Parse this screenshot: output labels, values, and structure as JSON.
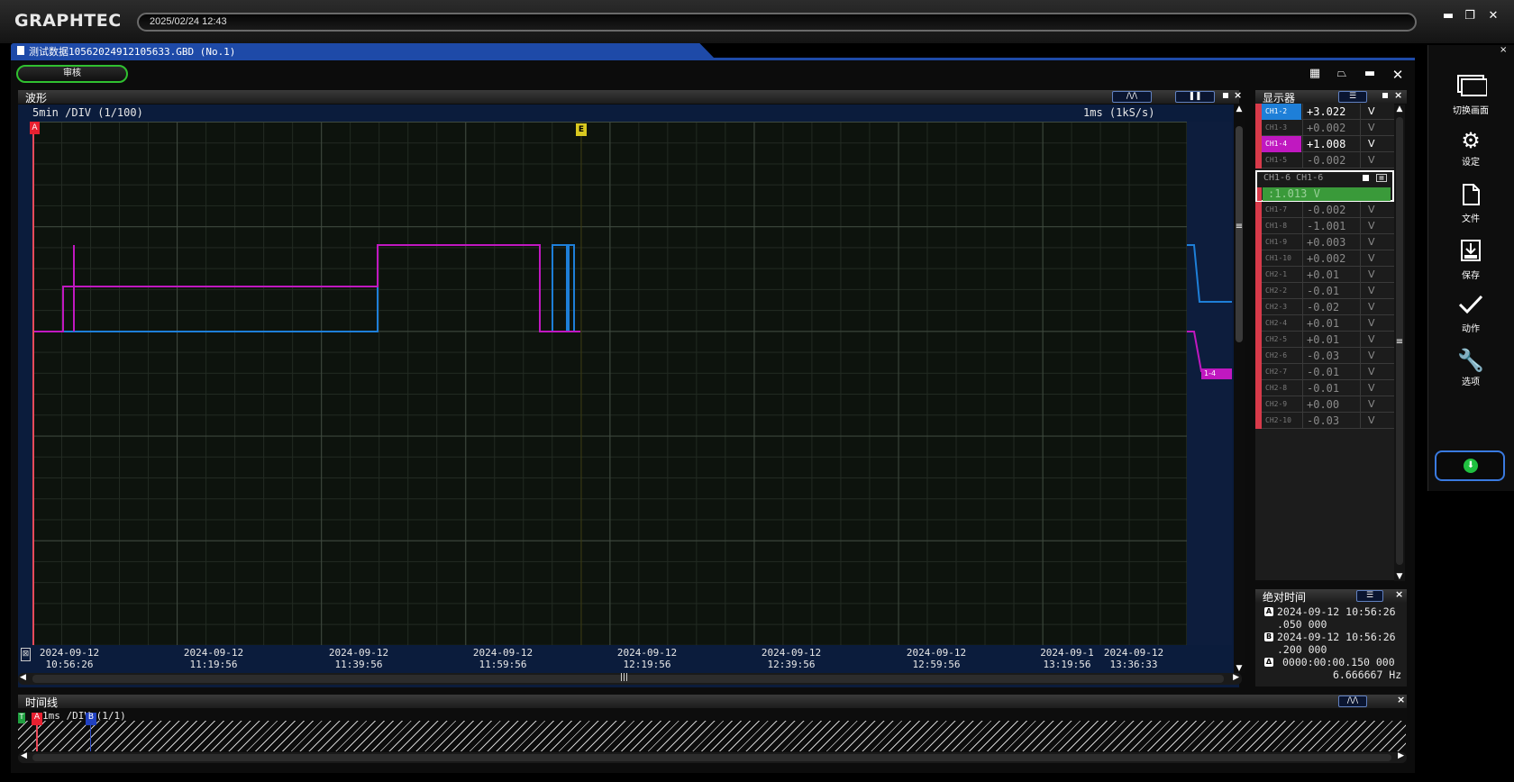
{
  "app": {
    "logo": "GRAPHTEC",
    "datetime": "2025/02/24 12:43"
  },
  "document_tab": {
    "title": "测试数据10562024912105633.GBD (No.1)"
  },
  "toolbar": {
    "review_button": "审核"
  },
  "waveform": {
    "title": "波形",
    "timebase": "5min  /DIV (1/100)",
    "sample_rate": "1ms (1kS/s)",
    "cursor_a": "A",
    "cursor_e": "E",
    "ch_tag": "1-4",
    "x_ticks": [
      {
        "date": "2024-09-12",
        "time": "10:56:26"
      },
      {
        "date": "2024-09-12",
        "time": "11:19:56"
      },
      {
        "date": "2024-09-12",
        "time": "11:39:56"
      },
      {
        "date": "2024-09-12",
        "time": "11:59:56"
      },
      {
        "date": "2024-09-12",
        "time": "12:19:56"
      },
      {
        "date": "2024-09-12",
        "time": "12:39:56"
      },
      {
        "date": "2024-09-12",
        "time": "12:59:56"
      },
      {
        "date": "2024-09-1",
        "time": "13:19:56"
      },
      {
        "date": "2024-09-12",
        "time": "13:36:33"
      }
    ]
  },
  "display_panel": {
    "title": "显示器",
    "channels": [
      {
        "name": "CH1-2",
        "value": "+3.022",
        "unit": "V",
        "active": true,
        "color": "#1e7fd8"
      },
      {
        "name": "CH1-3",
        "value": "+0.002",
        "unit": "V",
        "active": false
      },
      {
        "name": "CH1-4",
        "value": "+1.008",
        "unit": "V",
        "active": true,
        "color": "#c018c0"
      },
      {
        "name": "CH1-5",
        "value": "-0.002",
        "unit": "V",
        "active": false
      },
      {
        "name": "CH1-7",
        "value": "-0.002",
        "unit": "V",
        "active": false
      },
      {
        "name": "CH1-8",
        "value": "-1.001",
        "unit": "V",
        "active": false
      },
      {
        "name": "CH1-9",
        "value": "+0.003",
        "unit": "V",
        "active": false
      },
      {
        "name": "CH1-10",
        "value": "+0.002",
        "unit": "V",
        "active": false
      },
      {
        "name": "CH2-1",
        "value": "+0.01",
        "unit": "V",
        "active": false
      },
      {
        "name": "CH2-2",
        "value": "-0.01",
        "unit": "V",
        "active": false
      },
      {
        "name": "CH2-3",
        "value": "-0.02",
        "unit": "V",
        "active": false
      },
      {
        "name": "CH2-4",
        "value": "+0.01",
        "unit": "V",
        "active": false
      },
      {
        "name": "CH2-5",
        "value": "+0.01",
        "unit": "V",
        "active": false
      },
      {
        "name": "CH2-6",
        "value": "-0.03",
        "unit": "V",
        "active": false
      },
      {
        "name": "CH2-7",
        "value": "-0.01",
        "unit": "V",
        "active": false
      },
      {
        "name": "CH2-8",
        "value": "-0.01",
        "unit": "V",
        "active": false
      },
      {
        "name": "CH2-9",
        "value": "+0.00",
        "unit": "V",
        "active": false
      },
      {
        "name": "CH2-10",
        "value": "-0.03",
        "unit": "V",
        "active": false
      }
    ],
    "selected": {
      "name": "CH1-6 CH1-6",
      "value": ":1.013  V"
    }
  },
  "abs_time_panel": {
    "title": "绝对时间",
    "a_date": "2024-09-12 10:56:26",
    "a_frac": ".050 000",
    "b_date": "2024-09-12 10:56:26",
    "b_frac": ".200 000",
    "delta": "0000:00:00.150 000",
    "freq": "6.666667 Hz"
  },
  "timeline": {
    "title": "时间线",
    "timebase": "1ms /DIV (1/1)",
    "marker_t": "T",
    "marker_a": "A",
    "marker_b": "B"
  },
  "sidebar": {
    "items": [
      {
        "label": "切换画面",
        "icon": "screen-switch-icon"
      },
      {
        "label": "设定",
        "icon": "gear-icon"
      },
      {
        "label": "文件",
        "icon": "file-icon"
      },
      {
        "label": "保存",
        "icon": "save-icon"
      },
      {
        "label": "动作",
        "icon": "check-icon"
      },
      {
        "label": "选项",
        "icon": "wrench-icon"
      }
    ]
  }
}
